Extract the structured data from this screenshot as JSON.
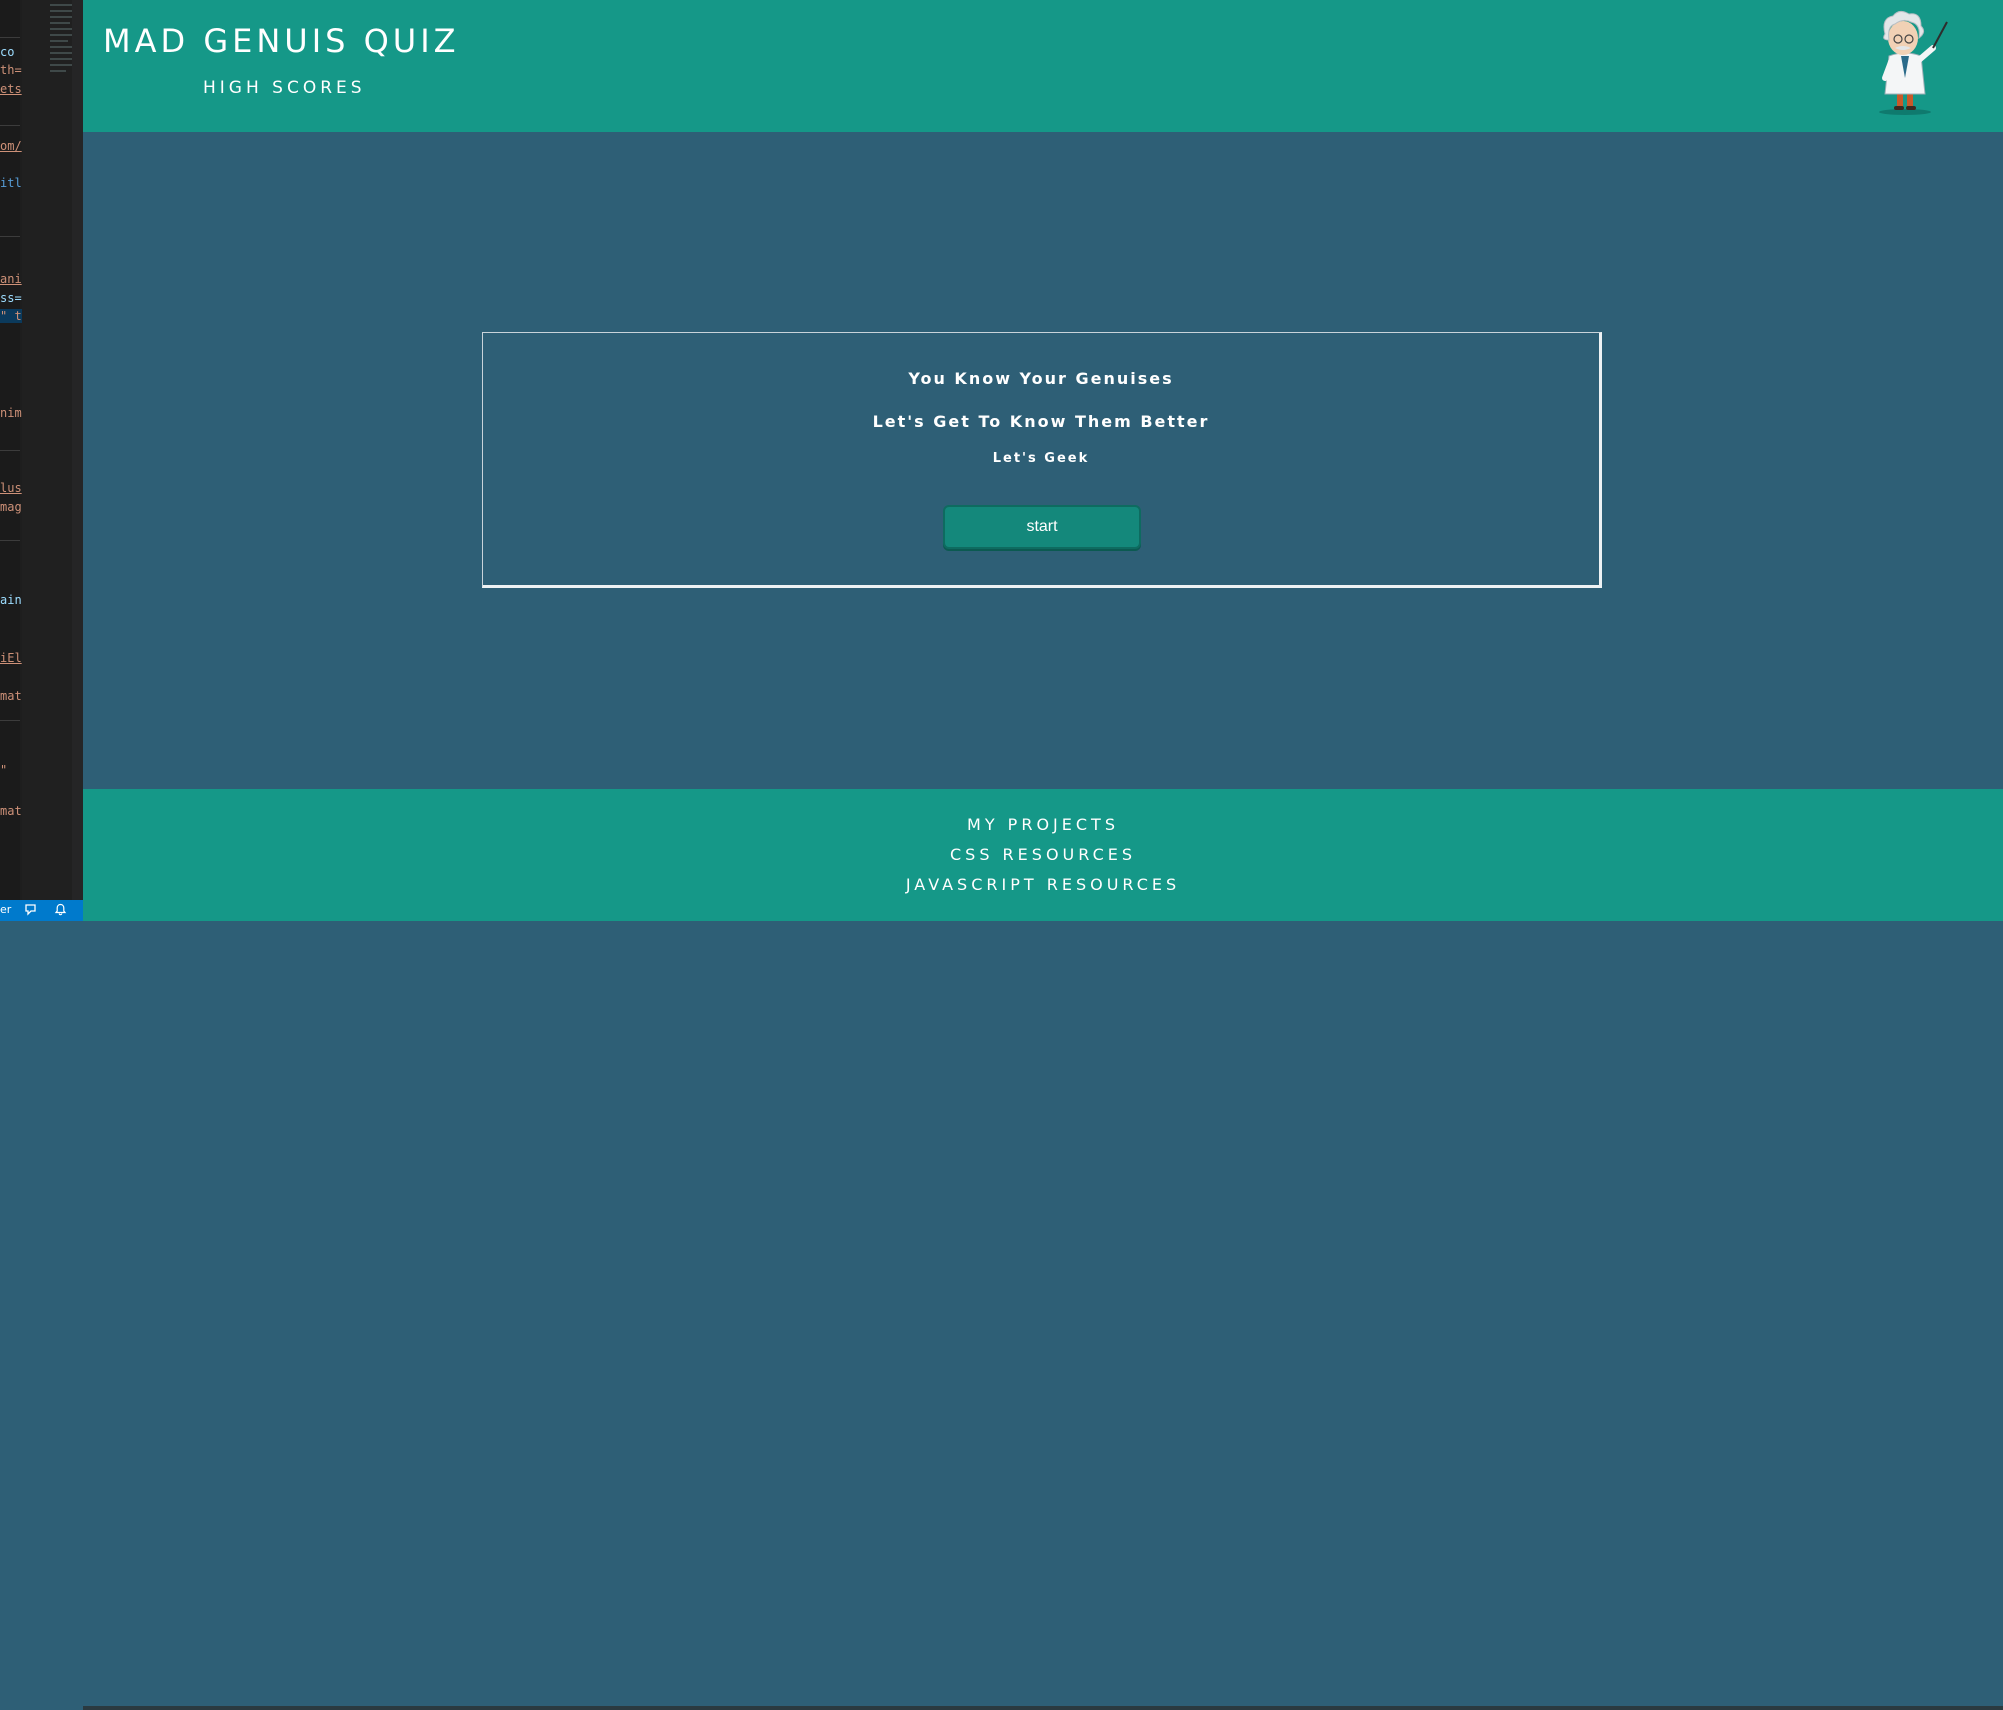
{
  "editor": {
    "fragments": [
      "co",
      "th=",
      "ets",
      "om/",
      "itl",
      "ani",
      "ss=",
      "\" t",
      "nim",
      "lus",
      "mag",
      "ain",
      "iEl",
      "mat",
      "\"",
      "mat"
    ]
  },
  "header": {
    "title": "MAD GENUIS QUIZ",
    "high_scores_link": "HIGH SCORES"
  },
  "quiz": {
    "heading_1": "You Know Your Genuises",
    "heading_2": "Let's Get To Know Them Better",
    "heading_3": "Let's Geek",
    "start_button": "start"
  },
  "footer": {
    "links": [
      "MY PROJECTS",
      "CSS RESOURCES",
      "JAVASCRIPT RESOURCES"
    ]
  },
  "status_bar": {
    "text": "er"
  },
  "colors": {
    "header_bg": "#159888",
    "main_bg": "#2e5f76",
    "button_bg": "#14887b",
    "status_bar": "#007acc"
  }
}
